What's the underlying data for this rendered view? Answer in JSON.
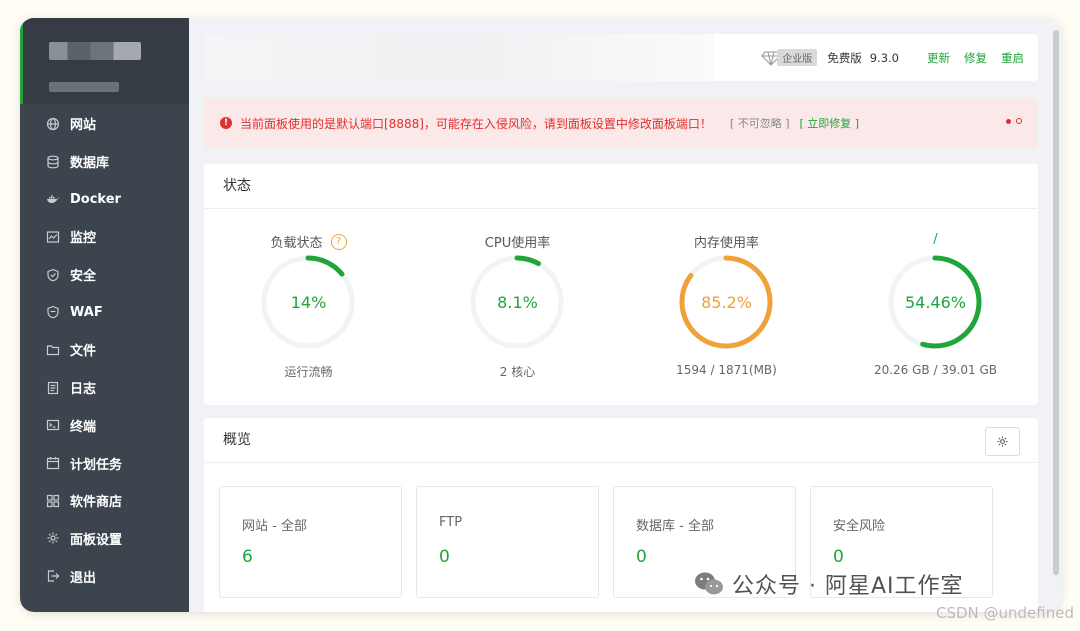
{
  "sidebar": {
    "items": [
      {
        "label": "网站",
        "icon": "globe-icon"
      },
      {
        "label": "数据库",
        "icon": "database-icon"
      },
      {
        "label": "Docker",
        "icon": "docker-icon"
      },
      {
        "label": "监控",
        "icon": "monitor-icon"
      },
      {
        "label": "安全",
        "icon": "shield-icon"
      },
      {
        "label": "WAF",
        "icon": "waf-shield-icon"
      },
      {
        "label": "文件",
        "icon": "folder-icon"
      },
      {
        "label": "日志",
        "icon": "log-icon"
      },
      {
        "label": "终端",
        "icon": "terminal-icon"
      },
      {
        "label": "计划任务",
        "icon": "calendar-icon"
      },
      {
        "label": "软件商店",
        "icon": "apps-icon"
      },
      {
        "label": "面板设置",
        "icon": "gear-icon"
      },
      {
        "label": "退出",
        "icon": "logout-icon"
      }
    ]
  },
  "topbar": {
    "enterprise_tag": "企业版",
    "free_label": "免费版",
    "version": "9.3.0",
    "update": "更新",
    "repair": "修复",
    "restart": "重启"
  },
  "alert": {
    "message": "当前面板使用的是默认端口[8888]，可能存在入侵风险，请到面板设置中修改面板端口！",
    "ignore": "[ 不可忽略 ]",
    "fix": "[ 立即修复 ]"
  },
  "status": {
    "title": "状态",
    "gauges": [
      {
        "title": "负载状态",
        "value": "14%",
        "percent": 14,
        "sub": "运行流畅",
        "color": "#20a53a",
        "help": true
      },
      {
        "title": "CPU使用率",
        "value": "8.1%",
        "percent": 8.1,
        "sub": "2 核心",
        "color": "#20a53a",
        "help": false
      },
      {
        "title": "内存使用率",
        "value": "85.2%",
        "percent": 85.2,
        "sub": "1594 / 1871(MB)",
        "color": "#f0a13a",
        "help": false
      },
      {
        "title": "/",
        "value": "54.46%",
        "percent": 54.46,
        "sub": "20.26 GB / 39.01 GB",
        "color": "#20a53a",
        "help": false
      }
    ]
  },
  "overview": {
    "title": "概览",
    "items": [
      {
        "label": "网站 - 全部",
        "value": "6"
      },
      {
        "label": "FTP",
        "value": "0"
      },
      {
        "label": "数据库 - 全部",
        "value": "0"
      },
      {
        "label": "安全风险",
        "value": "0"
      }
    ]
  },
  "watermark": {
    "text": "公众号 · 阿星AI工作室",
    "csdn": "CSDN @undefined"
  },
  "colors": {
    "accent": "#20a53a",
    "warning": "#f0a13a",
    "danger": "#e0302f",
    "sidebar_bg": "#3c444d"
  }
}
